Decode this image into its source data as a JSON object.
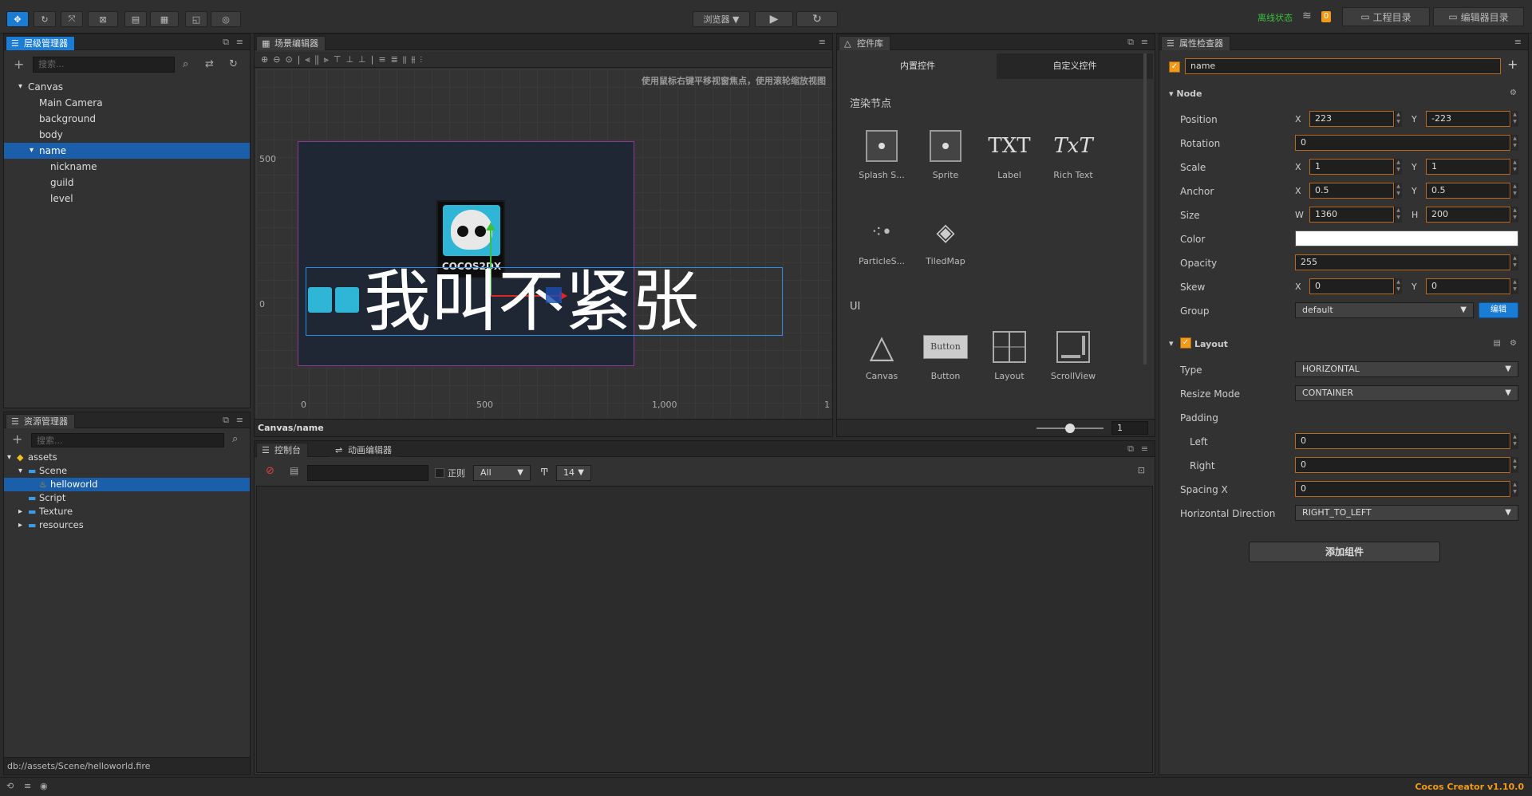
{
  "topbar": {
    "tools": [
      "✥",
      "↻",
      "⤧",
      "⊠"
    ],
    "preview_select": "浏览器",
    "play_icon": "▶",
    "refresh_icon": "↻",
    "status_text": "离线状态",
    "notify_count": "0",
    "project_dir": "工程目录",
    "editor_dir": "编辑器目录"
  },
  "hierarchy": {
    "title": "层级管理器",
    "search_placeholder": "搜索...",
    "nodes": [
      {
        "label": "Canvas",
        "depth": 0,
        "arrow": "▾"
      },
      {
        "label": "Main Camera",
        "depth": 1,
        "arrow": ""
      },
      {
        "label": "background",
        "depth": 1,
        "arrow": ""
      },
      {
        "label": "body",
        "depth": 1,
        "arrow": ""
      },
      {
        "label": "name",
        "depth": 1,
        "arrow": "▾",
        "selected": true
      },
      {
        "label": "nickname",
        "depth": 2,
        "arrow": ""
      },
      {
        "label": "guild",
        "depth": 2,
        "arrow": ""
      },
      {
        "label": "level",
        "depth": 2,
        "arrow": ""
      }
    ]
  },
  "assets": {
    "title": "资源管理器",
    "search_placeholder": "搜索...",
    "items": [
      {
        "label": "assets",
        "depth": 0,
        "arrow": "▾",
        "icon": "db"
      },
      {
        "label": "Scene",
        "depth": 1,
        "arrow": "▾",
        "icon": "folder"
      },
      {
        "label": "helloworld",
        "depth": 2,
        "arrow": "",
        "icon": "fire",
        "selected": true
      },
      {
        "label": "Script",
        "depth": 1,
        "arrow": "",
        "icon": "folder"
      },
      {
        "label": "Texture",
        "depth": 1,
        "arrow": "▸",
        "icon": "folder"
      },
      {
        "label": "resources",
        "depth": 1,
        "arrow": "▸",
        "icon": "folder"
      }
    ],
    "path": "db://assets/Scene/helloworld.fire"
  },
  "scene": {
    "title": "场景编辑器",
    "hint": "使用鼠标右键平移视窗焦点，使用滚轮缩放视图",
    "axis_y": [
      "500",
      "0"
    ],
    "axis_x": [
      "0",
      "500",
      "1,000",
      "1"
    ],
    "big_text": "我叫不紧张",
    "logo_text": "COCOS2DX",
    "path": "Canvas/name",
    "zoom_value": "1"
  },
  "widgets": {
    "title": "控件库",
    "tab_builtin": "内置控件",
    "tab_custom": "自定义控件",
    "section_render": "渲染节点",
    "section_ui": "UI",
    "render_items": [
      "Splash S...",
      "Sprite",
      "Label",
      "Rich Text",
      "ParticleS...",
      "TiledMap"
    ],
    "ui_items": [
      "Canvas",
      "Button",
      "Layout",
      "ScrollView"
    ],
    "button_preview": "Button",
    "label_glyph": "TXT",
    "richtext_glyph": "TxT"
  },
  "console": {
    "tab_console": "控制台",
    "tab_anim": "动画编辑器",
    "regex_label": "正则",
    "level_select": "All",
    "font_size": "14"
  },
  "inspector": {
    "title": "属性检查器",
    "node_name": "name",
    "node_section": "Node",
    "position_label": "Position",
    "pos_x": "223",
    "pos_y": "-223",
    "rotation_label": "Rotation",
    "rotation": "0",
    "scale_label": "Scale",
    "scale_x": "1",
    "scale_y": "1",
    "anchor_label": "Anchor",
    "anchor_x": "0.5",
    "anchor_y": "0.5",
    "size_label": "Size",
    "size_w": "1360",
    "size_h": "200",
    "color_label": "Color",
    "color_value": "#ffffff",
    "opacity_label": "Opacity",
    "opacity": "255",
    "skew_label": "Skew",
    "skew_x": "0",
    "skew_y": "0",
    "group_label": "Group",
    "group": "default",
    "edit_btn": "编辑",
    "layout_section": "Layout",
    "type_label": "Type",
    "type": "HORIZONTAL",
    "resize_label": "Resize Mode",
    "resize": "CONTAINER",
    "padding_label": "Padding",
    "left_label": "Left",
    "left": "0",
    "right_label": "Right",
    "right": "0",
    "spacing_label": "Spacing X",
    "spacing": "0",
    "hdir_label": "Horizontal Direction",
    "hdir": "RIGHT_TO_LEFT",
    "add_component": "添加组件",
    "x": "X",
    "y": "Y",
    "w": "W",
    "h": "H"
  },
  "statusbar": {
    "version": "Cocos Creator v1.10.0"
  },
  "colors": {
    "accent": "#1b7cd6",
    "selection": "#1b5faa",
    "orange": "#f29a1a",
    "status_green": "#3cc13c",
    "version_orange": "#f29a1a"
  }
}
